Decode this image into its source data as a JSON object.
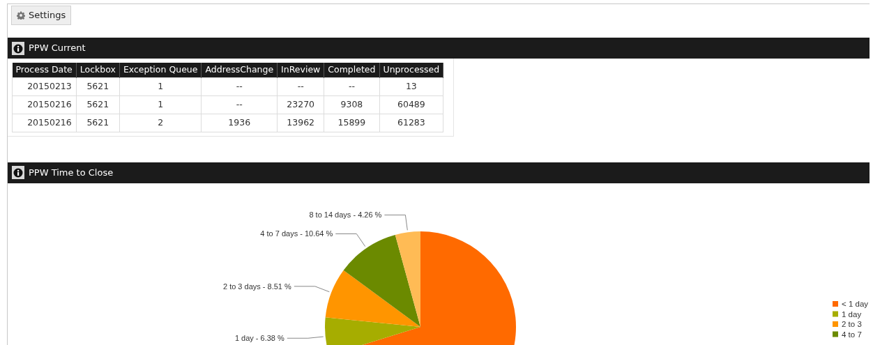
{
  "toolbar": {
    "settings_button": "Settings"
  },
  "panels": [
    {
      "kind": "table",
      "title": "PPW Current",
      "table": {
        "columns": [
          "Process Date",
          "Lockbox",
          "Exception Queue",
          "AddressChange",
          "InReview",
          "Completed",
          "Unprocessed"
        ],
        "rows": [
          [
            "20150213",
            "5621",
            "1",
            "--",
            "--",
            "--",
            "13"
          ],
          [
            "20150216",
            "5621",
            "1",
            "--",
            "23270",
            "9308",
            "60489"
          ],
          [
            "20150216",
            "5621",
            "2",
            "1936",
            "13962",
            "15899",
            "61283"
          ]
        ]
      }
    },
    {
      "kind": "chart",
      "title": "PPW Time to Close",
      "chart_data": {
        "type": "pie",
        "series": [
          {
            "values": [
              70.21,
              6.38,
              8.51,
              10.64,
              4.26
            ]
          }
        ],
        "value_labels": [
          null,
          "1 day - 6.38 %",
          "2 to 3 days - 8.51 %",
          "4 to 7 days - 10.64 %",
          "8 to 14 days - 4.26 %"
        ]
      },
      "slices": [
        {
          "color": "#ff6a00"
        },
        {
          "color": "#a6ad00"
        },
        {
          "color": "#ff9500"
        },
        {
          "color": "#6b8a00"
        },
        {
          "color": "#ffbb55"
        }
      ],
      "legend": [
        {
          "label": "< 1 day"
        },
        {
          "label": "1 day"
        },
        {
          "label": "2 to 3"
        },
        {
          "label": "4 to 7"
        }
      ]
    }
  ]
}
